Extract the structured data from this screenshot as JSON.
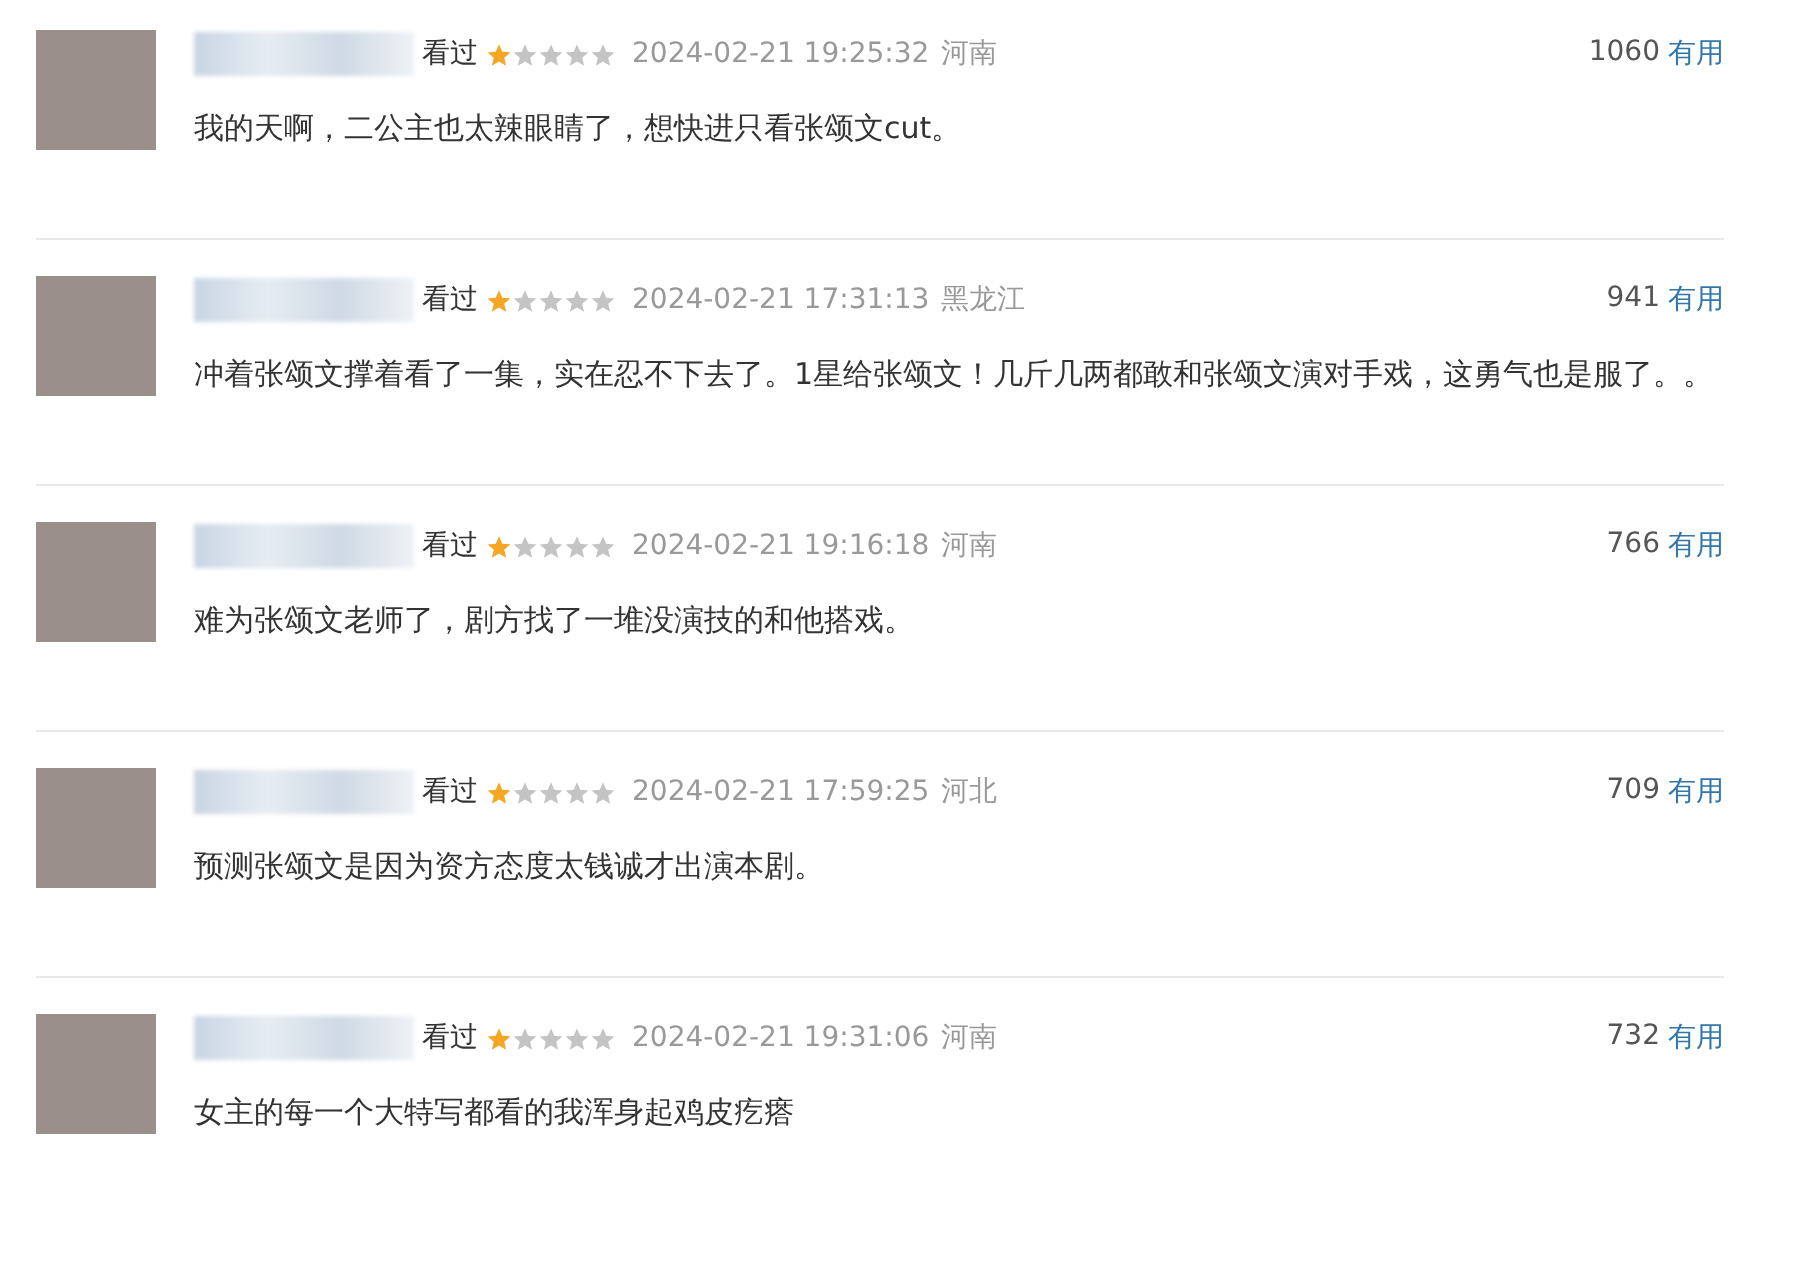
{
  "comments": [
    {
      "status": "看过",
      "stars": 1,
      "time": "2024-02-21 19:25:32",
      "location": "河南",
      "count": "1060",
      "useful": "有用",
      "text": "我的天啊，二公主也太辣眼睛了，想快进只看张颂文cut。"
    },
    {
      "status": "看过",
      "stars": 1,
      "time": "2024-02-21 17:31:13",
      "location": "黑龙江",
      "count": "941",
      "useful": "有用",
      "text": "冲着张颂文撑着看了一集，实在忍不下去了。1星给张颂文！几斤几两都敢和张颂文演对手戏，这勇气也是服了。。"
    },
    {
      "status": "看过",
      "stars": 1,
      "time": "2024-02-21 19:16:18",
      "location": "河南",
      "count": "766",
      "useful": "有用",
      "text": "难为张颂文老师了，剧方找了一堆没演技的和他搭戏。"
    },
    {
      "status": "看过",
      "stars": 1,
      "time": "2024-02-21 17:59:25",
      "location": "河北",
      "count": "709",
      "useful": "有用",
      "text": "预测张颂文是因为资方态度太钱诚才出演本剧。"
    },
    {
      "status": "看过",
      "stars": 1,
      "time": "2024-02-21 19:31:06",
      "location": "河南",
      "count": "732",
      "useful": "有用",
      "text": "女主的每一个大特写都看的我浑身起鸡皮疙瘩"
    }
  ]
}
